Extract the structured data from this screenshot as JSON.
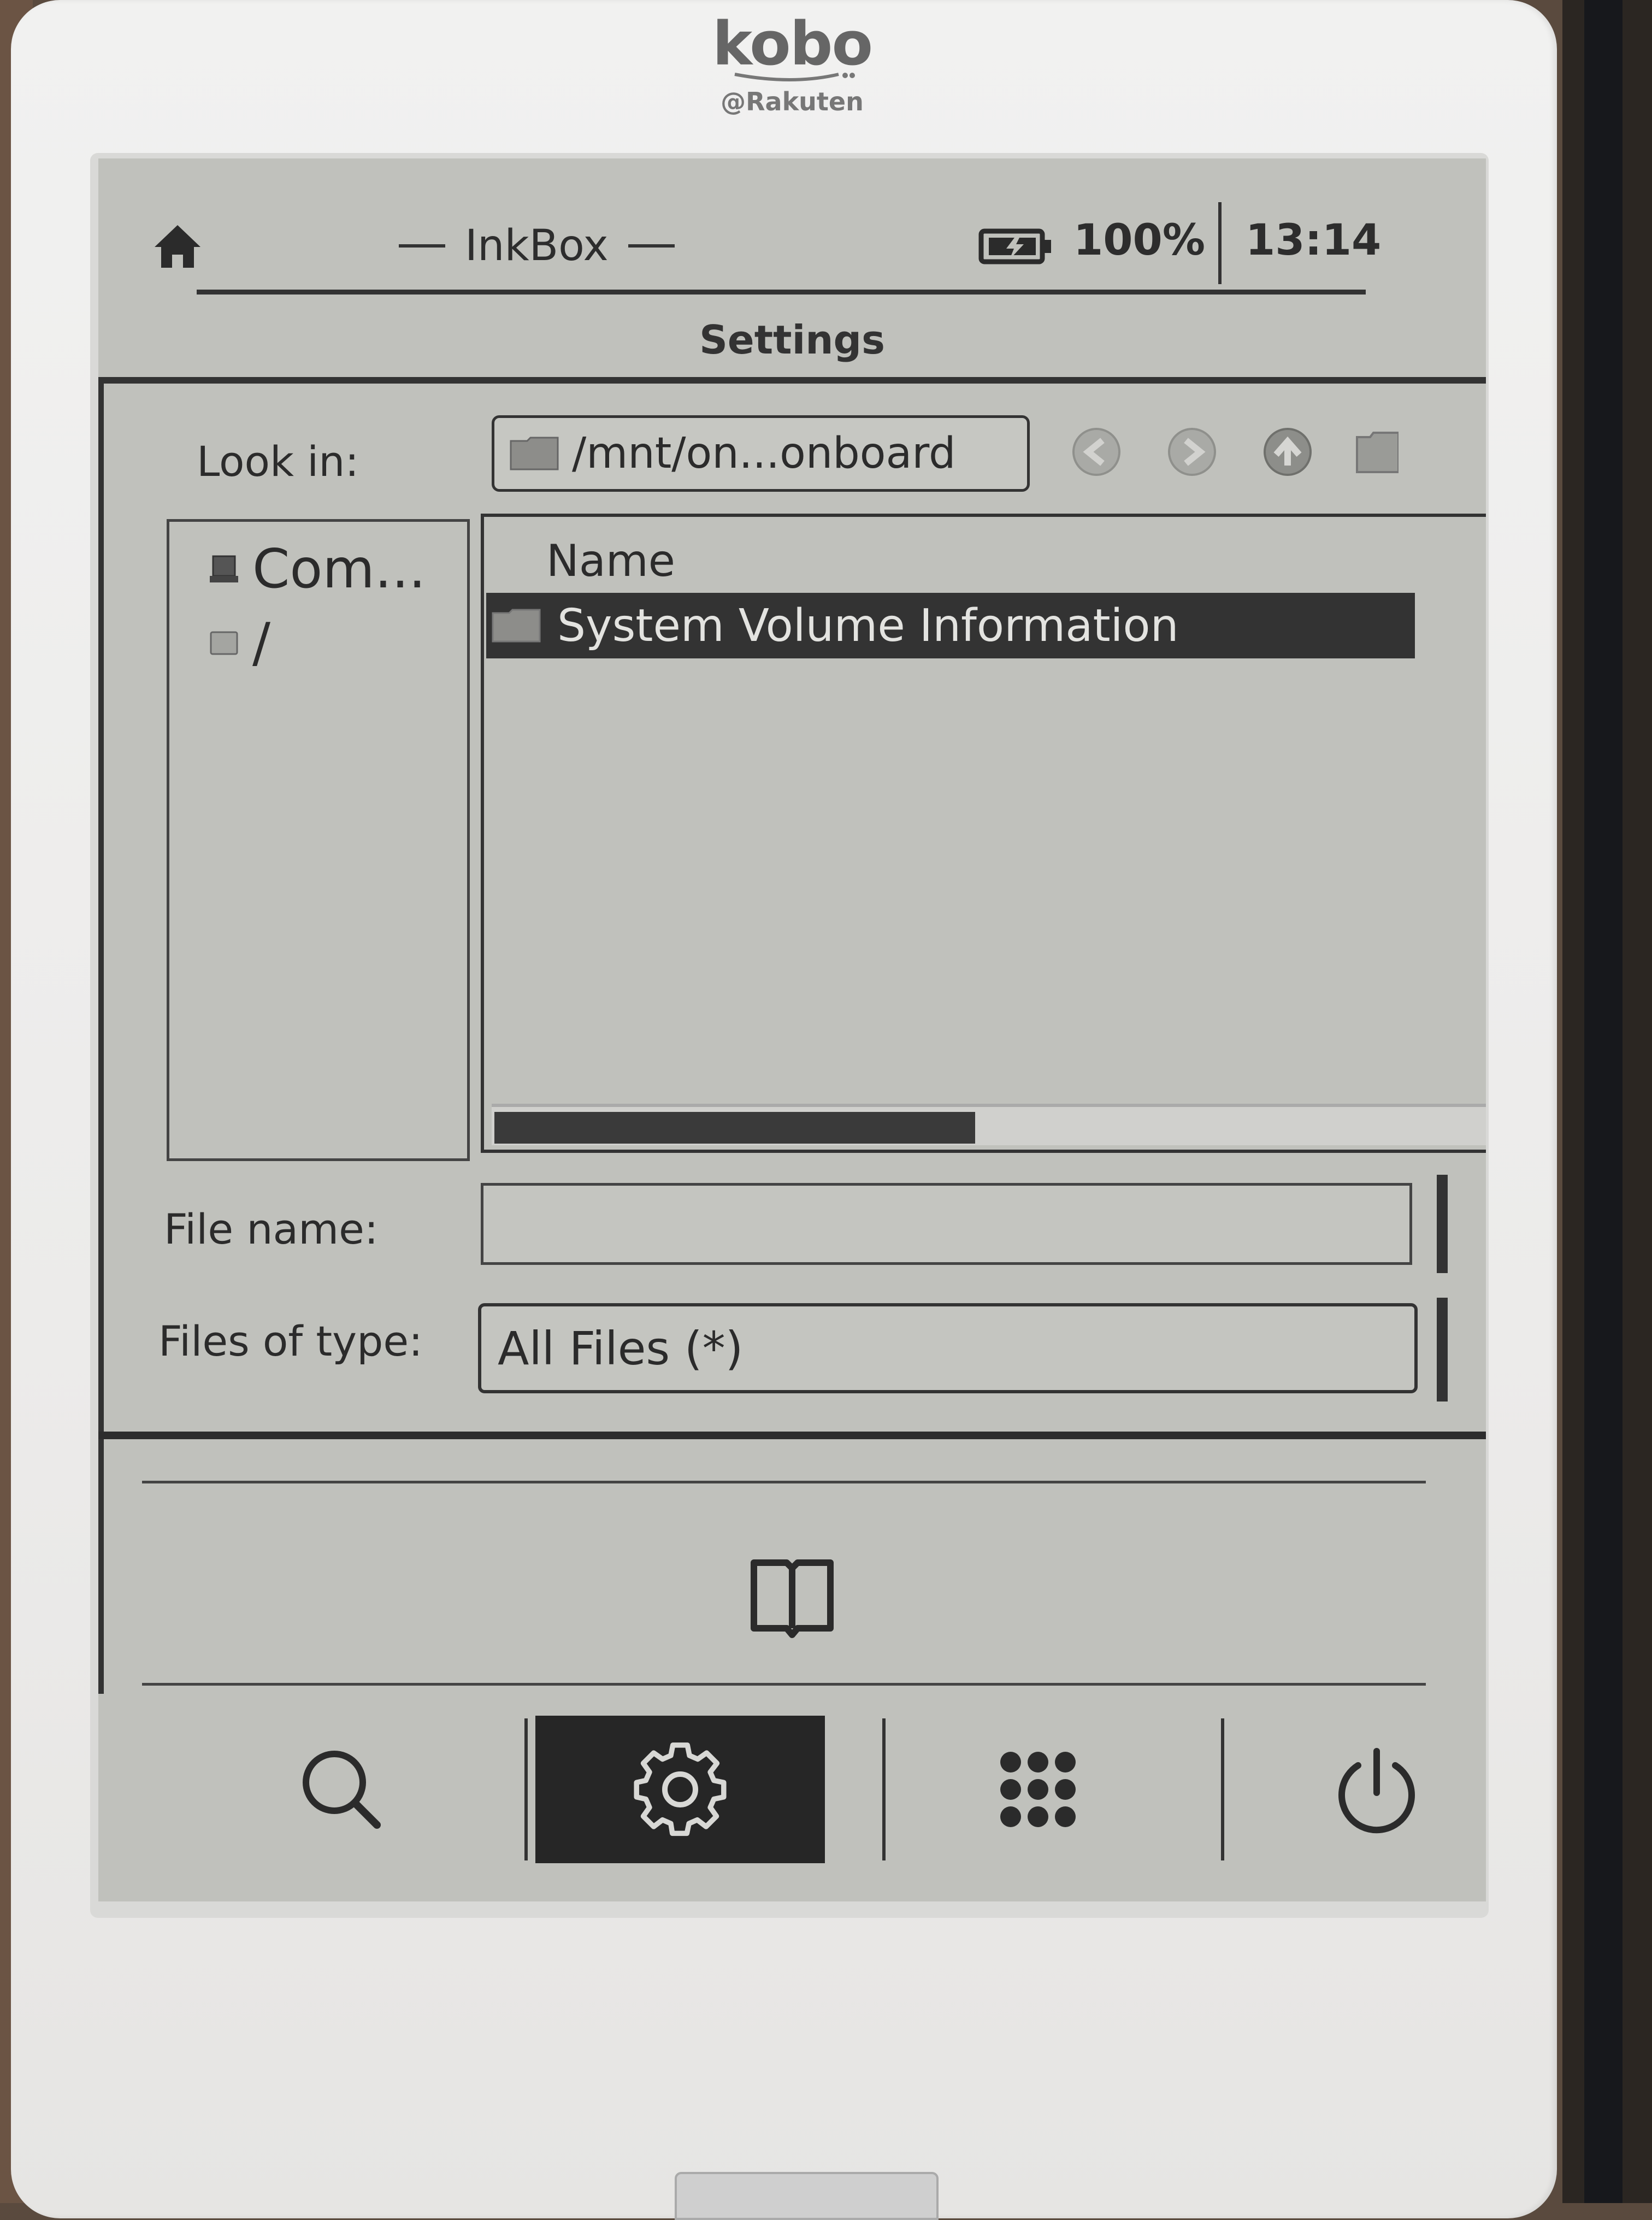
{
  "device": {
    "brand": "kobo",
    "sub_brand": "@Rakuten"
  },
  "topbar": {
    "app_title": "InkBox",
    "battery": "100%",
    "clock": "13:14"
  },
  "dialog": {
    "title": "Settings",
    "look_in_label": "Look in:",
    "path": "/mnt/on...onboard",
    "places": [
      {
        "label": "Com..."
      },
      {
        "label": "/"
      }
    ],
    "column_header": "Name",
    "files": [
      {
        "name": "System Volume Information",
        "selected": true
      }
    ],
    "file_name_label": "File name:",
    "file_name_value": "",
    "files_of_type_label": "Files of type:",
    "files_of_type_value": "All Files (*)"
  },
  "bottom_nav": {
    "items": [
      "search-icon",
      "gear-icon",
      "apps-grid-icon",
      "power-icon"
    ],
    "active": "gear-icon"
  },
  "colors": {
    "screen_bg": "#c0c1bc",
    "ink": "#2b2b2b",
    "selection": "#333333"
  }
}
